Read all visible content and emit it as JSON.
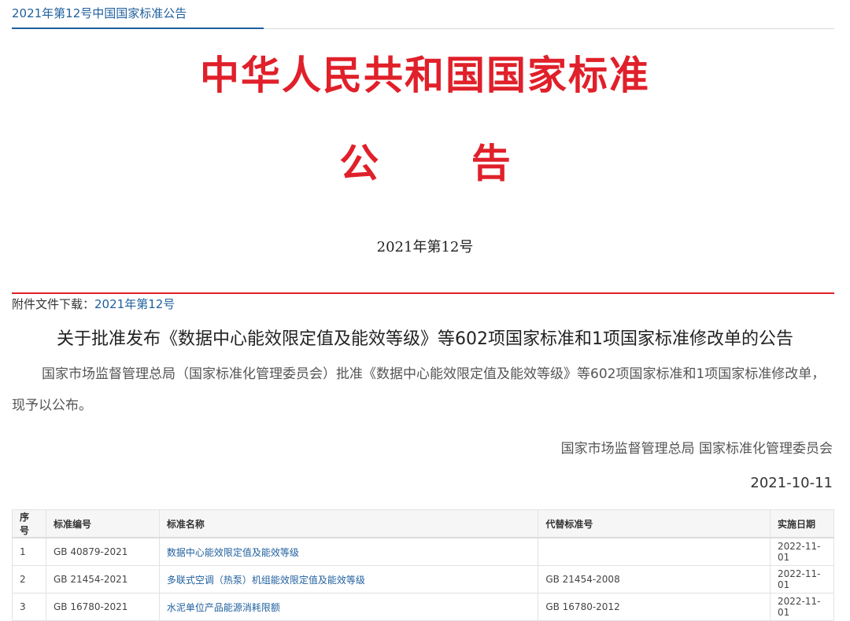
{
  "header": {
    "breadcrumb_title": "2021年第12号中国国家标准公告"
  },
  "masthead": {
    "title": "中华人民共和国国家标准",
    "subtitle": "公 告",
    "issue": "2021年第12号"
  },
  "attachment": {
    "label": "附件文件下载：",
    "link_text": "2021年第12号"
  },
  "notice": {
    "title": "关于批准发布《数据中心能效限定值及能效等级》等602项国家标准和1项国家标准修改单的公告",
    "body": "国家市场监督管理总局（国家标准化管理委员会）批准《数据中心能效限定值及能效等级》等602项国家标准和1项国家标准修改单，现予以公布。",
    "signer": "国家市场监督管理总局 国家标准化管理委员会",
    "date": "2021-10-11"
  },
  "table": {
    "headers": [
      "序号",
      "标准编号",
      "标准名称",
      "代替标准号",
      "实施日期"
    ],
    "rows": [
      [
        "1",
        "GB 40879-2021",
        "数据中心能效限定值及能效等级",
        "",
        "2022-11-01"
      ],
      [
        "2",
        "GB 21454-2021",
        "多联式空调（热泵）机组能效限定值及能效等级",
        "GB 21454-2008",
        "2022-11-01"
      ],
      [
        "3",
        "GB 16780-2021",
        "水泥单位产品能源消耗限额",
        "GB 16780-2012",
        "2022-11-01"
      ]
    ]
  }
}
